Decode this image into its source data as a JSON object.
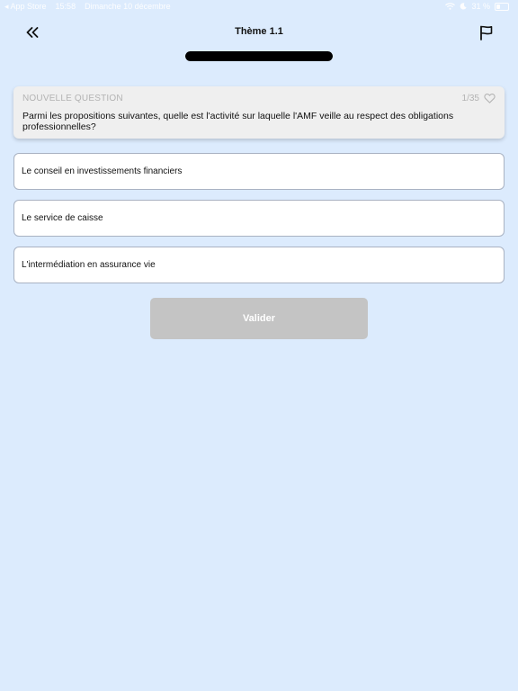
{
  "status_bar": {
    "back_app": "◂ App Store",
    "time": "15:58",
    "date": "Dimanche 10 décembre",
    "battery_percent": "31 %"
  },
  "header": {
    "title": "Thème 1.1",
    "back_icon": "double-chevron-left-icon",
    "flag_icon": "flag-icon"
  },
  "progress": {
    "fraction": 1.0
  },
  "question": {
    "label": "NOUVELLE QUESTION",
    "counter": "1/35",
    "text": "Parmi les propositions suivantes, quelle est l'activité sur laquelle l'AMF veille au respect des obligations professionnelles?",
    "favorite_icon": "heart-outline-icon"
  },
  "answers": [
    {
      "label": "Le conseil en investissements financiers"
    },
    {
      "label": "Le service de caisse"
    },
    {
      "label": "L'intermédiation en assurance vie"
    }
  ],
  "actions": {
    "validate_label": "Valider"
  },
  "colors": {
    "background": "#dcebfd",
    "validate_disabled": "#c4c4c4",
    "progress_fill": "#000000"
  }
}
